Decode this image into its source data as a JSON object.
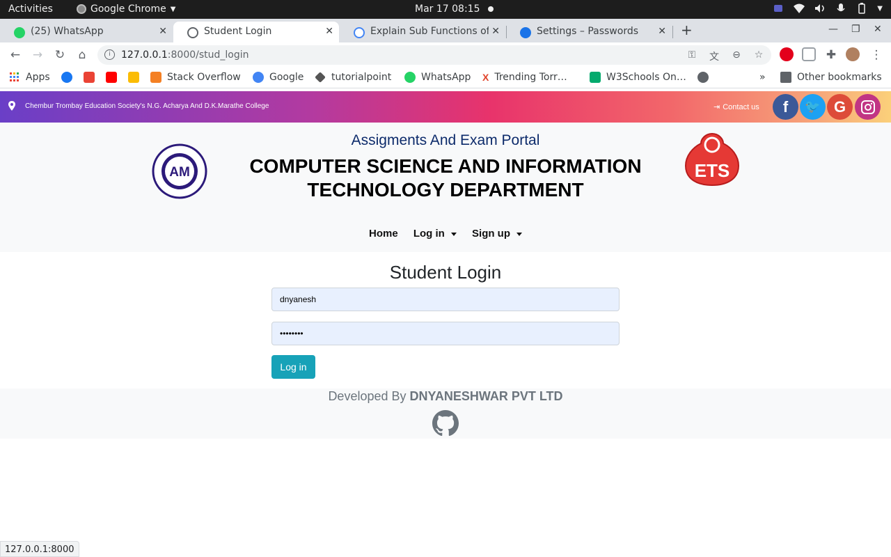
{
  "system_bar": {
    "activities": "Activities",
    "app_name": "Google Chrome",
    "clock": "Mar 17  08:15"
  },
  "tabs": [
    {
      "title": "(25) WhatsApp",
      "favicon_color": "#25d366",
      "active": false
    },
    {
      "title": "Student Login",
      "favicon_color": "#5f6368",
      "active": true
    },
    {
      "title": "Explain Sub Functions of ",
      "favicon_color": "#4285f4",
      "active": false
    },
    {
      "title": "Settings – Passwords",
      "favicon_color": "#1a73e8",
      "active": false
    }
  ],
  "toolbar": {
    "url_host": "127.0.0.1",
    "url_rest": ":8000/stud_login"
  },
  "bookmarks": {
    "apps": "Apps",
    "items": [
      "Stack Overflow",
      "Google",
      "tutorialpoint",
      "WhatsApp",
      "Trending Torr…",
      "W3Schools On…"
    ],
    "overflow": "»",
    "other": "Other bookmarks"
  },
  "site": {
    "college": "Chembur Trombay Education Society's N.G. Acharya And D.K.Marathe College",
    "contact": "Contact us",
    "social": [
      "facebook",
      "twitter",
      "google",
      "instagram"
    ],
    "social_colors": [
      "#3b5998",
      "#1da1f2",
      "#dd4b39",
      "#c13584"
    ],
    "portal_title": "Assigments And Exam Portal",
    "dept_title": "COMPUTER SCIENCE AND INFORMATION TECHNOLOGY DEPARTMENT",
    "nav": {
      "home": "Home",
      "login": "Log in",
      "signup": "Sign up"
    }
  },
  "login": {
    "title": "Student Login",
    "username_value": "dnyanesh",
    "password_value": "••••••••",
    "button": "Log in"
  },
  "footer": {
    "prefix": "Developed By",
    "company": "DNYANESHWAR PVT LTD"
  },
  "status_bar": "127.0.0.1:8000"
}
